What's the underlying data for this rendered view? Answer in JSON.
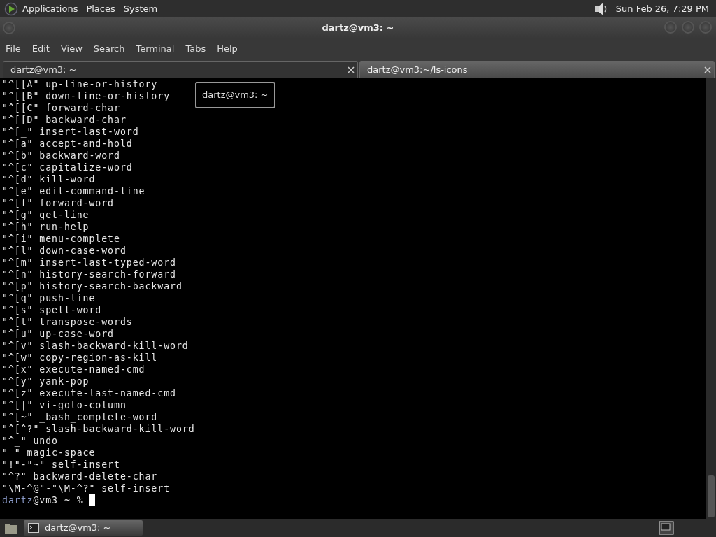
{
  "top_panel": {
    "menus": [
      "Applications",
      "Places",
      "System"
    ],
    "clock": "Sun Feb 26,  7:29 PM"
  },
  "window": {
    "title": "dartz@vm3: ~",
    "menu": [
      "File",
      "Edit",
      "View",
      "Search",
      "Terminal",
      "Tabs",
      "Help"
    ],
    "tabs": [
      {
        "label": "dartz@vm3: ~",
        "selected": true
      },
      {
        "label": "dartz@vm3:~/ls-icons",
        "selected": false
      }
    ],
    "terminal": {
      "lines": [
        "\"^[[A\" up-line-or-history",
        "\"^[[B\" down-line-or-history",
        "\"^[[C\" forward-char",
        "\"^[[D\" backward-char",
        "\"^[_\" insert-last-word",
        "\"^[a\" accept-and-hold",
        "\"^[b\" backward-word",
        "\"^[c\" capitalize-word",
        "\"^[d\" kill-word",
        "\"^[e\" edit-command-line",
        "\"^[f\" forward-word",
        "\"^[g\" get-line",
        "\"^[h\" run-help",
        "\"^[i\" menu-complete",
        "\"^[l\" down-case-word",
        "\"^[m\" insert-last-typed-word",
        "\"^[n\" history-search-forward",
        "\"^[p\" history-search-backward",
        "\"^[q\" push-line",
        "\"^[s\" spell-word",
        "\"^[t\" transpose-words",
        "\"^[u\" up-case-word",
        "\"^[v\" slash-backward-kill-word",
        "\"^[w\" copy-region-as-kill",
        "\"^[x\" execute-named-cmd",
        "\"^[y\" yank-pop",
        "\"^[z\" execute-last-named-cmd",
        "\"^[|\" vi-goto-column",
        "\"^[~\" _bash_complete-word",
        "\"^[^?\" slash-backward-kill-word",
        "\"^_\" undo",
        "\" \" magic-space",
        "\"!\"-\"~\" self-insert",
        "\"^?\" backward-delete-char",
        "\"\\M-^@\"-\"\\M-^?\" self-insert"
      ],
      "prompt": {
        "user": "dartz",
        "rest": "@vm3 ~ %"
      },
      "tooltip": "dartz@vm3: ~"
    }
  },
  "taskbar": {
    "tasks": [
      {
        "label": "dartz@vm3: ~",
        "selected": true
      }
    ]
  }
}
